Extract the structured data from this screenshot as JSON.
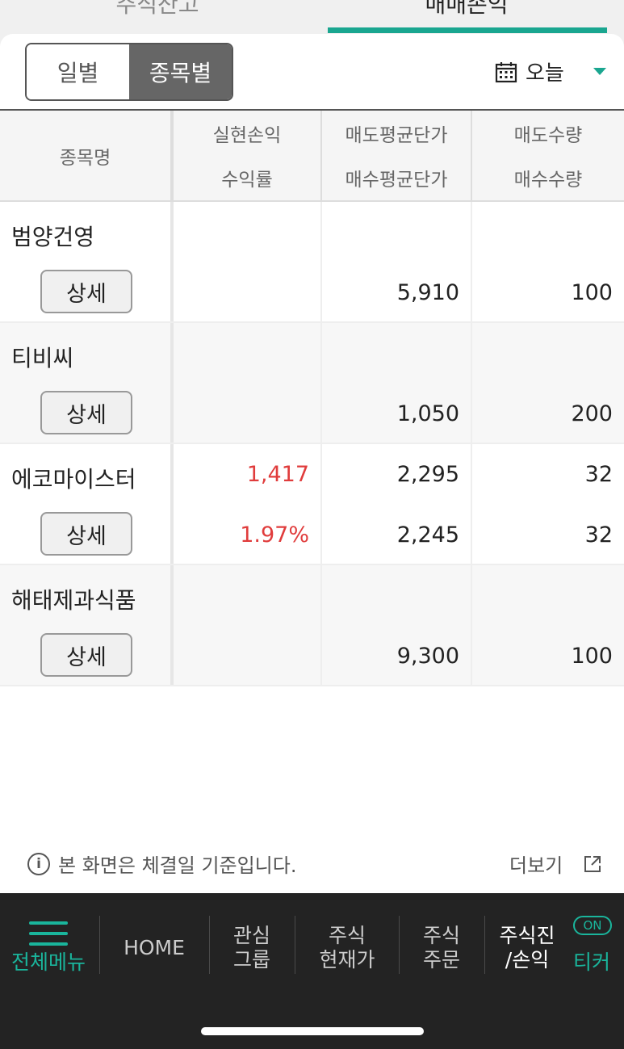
{
  "top_tabs": [
    "주식잔고",
    "매매손익"
  ],
  "segment": {
    "daily": "일별",
    "by_stock": "종목별",
    "active": "by_stock"
  },
  "date": {
    "label": "오늘"
  },
  "table": {
    "headers": {
      "name": "종목명",
      "realized": "실현손익",
      "rate": "수익률",
      "sell_avg": "매도평균단가",
      "buy_avg": "매수평균단가",
      "sell_qty": "매도수량",
      "buy_qty": "매수수량"
    },
    "detail_label": "상세",
    "rows": [
      {
        "name": "범양건영",
        "realized": "",
        "rate": "",
        "sell_avg": "",
        "buy_avg": "5,910",
        "sell_qty": "",
        "buy_qty": "100"
      },
      {
        "name": "티비씨",
        "realized": "",
        "rate": "",
        "sell_avg": "",
        "buy_avg": "1,050",
        "sell_qty": "",
        "buy_qty": "200"
      },
      {
        "name": "에코마이스터",
        "realized": "1,417",
        "rate": "1.97%",
        "sell_avg": "2,295",
        "buy_avg": "2,245",
        "sell_qty": "32",
        "buy_qty": "32"
      },
      {
        "name": "해태제과식품",
        "realized": "",
        "rate": "",
        "sell_avg": "",
        "buy_avg": "9,300",
        "sell_qty": "",
        "buy_qty": "100"
      }
    ]
  },
  "notice": "본 화면은 체결일 기준입니다.",
  "more_label": "더보기",
  "bottom_nav": {
    "menu": "전체메뉴",
    "home": "HOME",
    "watch_1": "관심",
    "watch_2": "그룹",
    "price_1": "주식",
    "price_2": "현재가",
    "order_1": "주식",
    "order_2": "주문",
    "progress_1": "주식진",
    "progress_2": "/손익",
    "on_badge": "ON",
    "ticker": "티커"
  },
  "colors": {
    "accent": "#1aa690",
    "loss_profit_red": "#e03c3c"
  }
}
